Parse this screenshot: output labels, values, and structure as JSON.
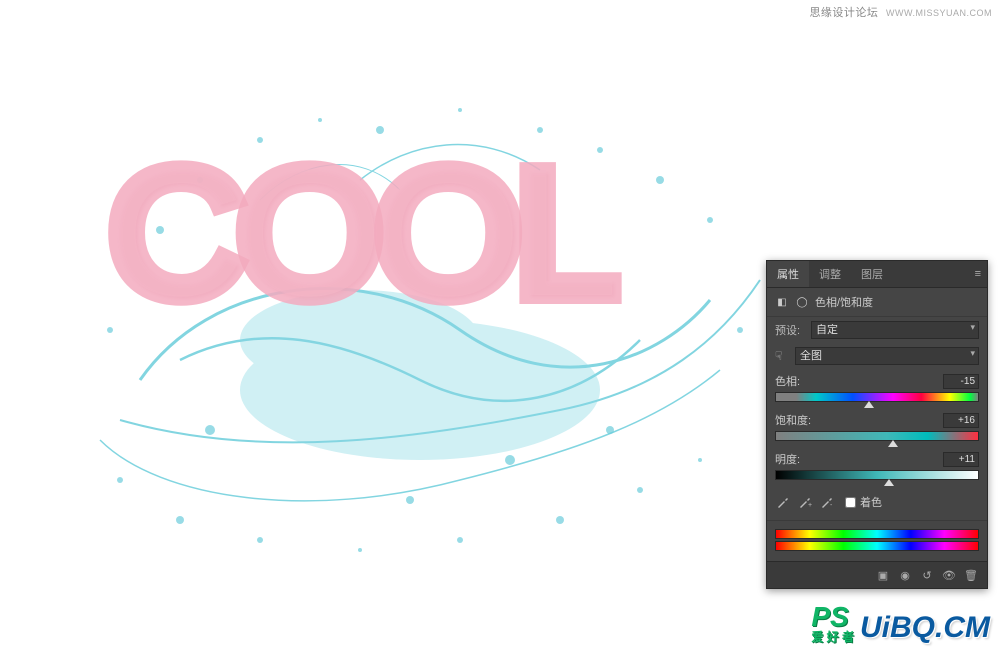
{
  "watermark_top": {
    "text": "思缘设计论坛",
    "url": "WWW.MISSYUAN.COM"
  },
  "artwork": {
    "text": "COOL"
  },
  "panel": {
    "tabs": [
      "属性",
      "调整",
      "图层"
    ],
    "active_tab": 0,
    "title": "色相/饱和度",
    "preset_label": "预设:",
    "preset_value": "自定",
    "channel_value": "全图",
    "sliders": {
      "hue": {
        "label": "色相:",
        "value": "-15",
        "pos": 46
      },
      "saturation": {
        "label": "饱和度:",
        "value": "+16",
        "pos": 58
      },
      "lightness": {
        "label": "明度:",
        "value": "+11",
        "pos": 56
      }
    },
    "colorize_label": "着色"
  },
  "watermark_bottom": {
    "ps": "PS",
    "ps_sub": "爱 好 者",
    "uibo": "UiBQ.CM"
  }
}
